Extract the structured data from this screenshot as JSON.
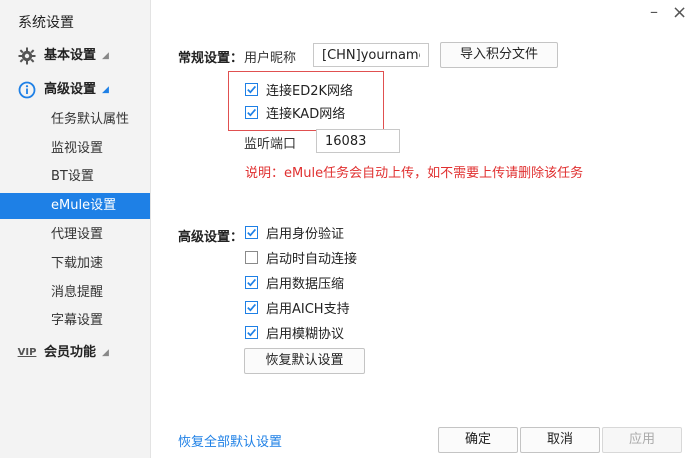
{
  "window": {
    "title": "系统设置",
    "minimize": "–",
    "close": "×"
  },
  "sidebar": {
    "basic": {
      "label": "基本设置"
    },
    "advanced": {
      "label": "高级设置"
    },
    "items": [
      {
        "label": "任务默认属性"
      },
      {
        "label": "监视设置"
      },
      {
        "label": "BT设置"
      },
      {
        "label": "eMule设置"
      },
      {
        "label": "代理设置"
      },
      {
        "label": "下载加速"
      },
      {
        "label": "消息提醒"
      },
      {
        "label": "字幕设置"
      }
    ],
    "vip": {
      "icon_text": "VIP",
      "label": "会员功能"
    }
  },
  "general": {
    "section_label": "常规设置：",
    "nickname_label": "用户昵称",
    "nickname_value": "[CHN]yourname",
    "import_button": "导入积分文件",
    "ed2k_label": "连接ED2K网络",
    "kad_label": "连接KAD网络",
    "port_label": "监听端口",
    "port_value": "16083",
    "note": "说明：eMule任务会自动上传，如不需要上传请删除该任务"
  },
  "advanced": {
    "section_label": "高级设置：",
    "options": [
      {
        "label": "启用身份验证",
        "checked": true
      },
      {
        "label": "启动时自动连接",
        "checked": false
      },
      {
        "label": "启用数据压缩",
        "checked": true
      },
      {
        "label": "启用AICH支持",
        "checked": true
      },
      {
        "label": "启用模糊协议",
        "checked": true
      }
    ],
    "restore_button": "恢复默认设置"
  },
  "footer": {
    "restore_all_link": "恢复全部默认设置",
    "ok": "确定",
    "cancel": "取消",
    "apply": "应用"
  },
  "colors": {
    "accent": "#1e80e6",
    "warning": "#e03030",
    "highlight_border": "#e05050"
  }
}
